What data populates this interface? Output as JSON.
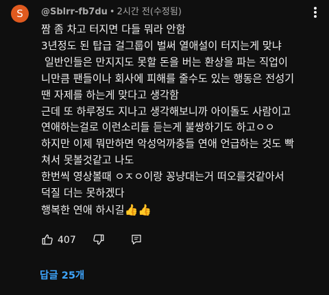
{
  "comment": {
    "avatar_letter": "S",
    "avatar_color": "#e05a1f",
    "author": "@Sblrr-fb7du",
    "separator": "•",
    "time": "2시간 전(수정됨)",
    "menu_icon": "more-vert-icon",
    "lines": [
      "짬 좀 차고 터지면 다들 뭐라 안함",
      "3년정도 된 탑급 걸그룹이 벌써 열애설이 터지는게 맞냐",
      " 일반인들은 만지지도 못할 돈을 버는 환상을 파는 직업이",
      "니만큼 팬들이나 회사에 피해를 줄수도 있는 행동은 전성기",
      "땐 자제를 하는게 맞다고 생각함",
      "근데 또 하루정도 지나고 생각해보니까 아이돌도 사람이고",
      "연애하는걸로 이런소리들 듣는게 불쌍하기도 하고ㅇㅇ",
      "하지만 이제 뭐만하면 악성억까충들 연애 언급하는 것도 빡",
      "쳐서 못볼것같고 나도",
      "한번씩 영상볼때 ㅇㅈㅇ이랑 꽁냥대는거 떠오를것같아서",
      "덕질 더는 못하겠다",
      "행복한 연애 하시길"
    ],
    "closing_emoji": "👍👍",
    "like_count": "407",
    "replies_label": "답글 25개",
    "accent_color": "#3ea6ff"
  }
}
